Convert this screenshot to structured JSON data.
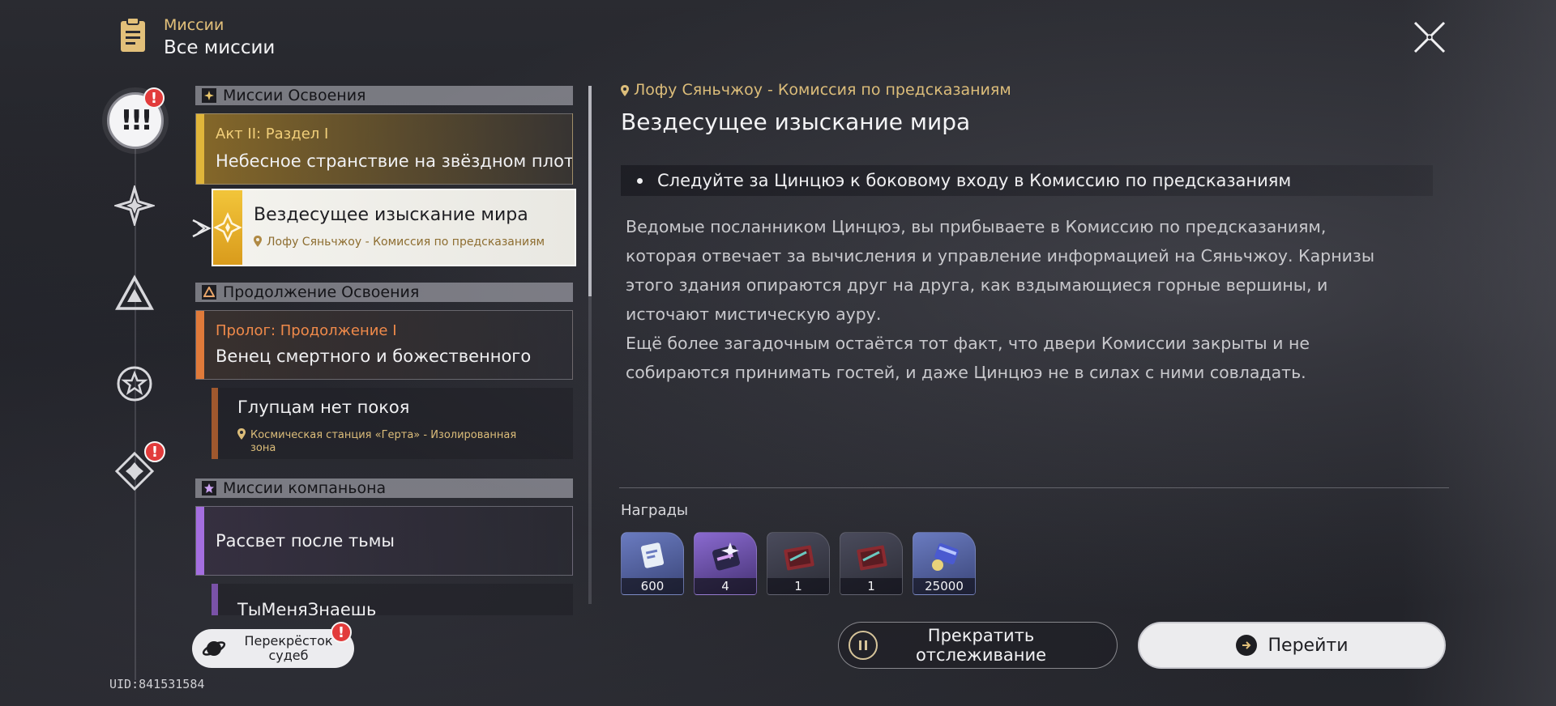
{
  "header": {
    "category": "Миссии",
    "title": "Все миссии"
  },
  "rail": {
    "active_label": "!!!",
    "badge": "!"
  },
  "uid": "UID:841531584",
  "list": {
    "categories": [
      {
        "label": "Миссии Освоения"
      },
      {
        "label": "Продолжение Освоения"
      },
      {
        "label": "Миссии компаньона"
      }
    ],
    "cards": [
      {
        "subtitle": "Акт II: Раздел I",
        "title": "Небесное странствие на звёздном плоту"
      },
      {
        "subtitle": "Пролог: Продолжение I",
        "title": "Венец смертного и божественного"
      },
      {
        "subtitle": "",
        "title": "Рассвет после тьмы"
      }
    ],
    "selected": {
      "title": "Вездесущее изыскание мира",
      "location": "Лофу Сяньчжоу - Комиссия по предсказаниям"
    },
    "sub_items": [
      {
        "title": "Глупцам нет покоя",
        "location_line1": "Космическая станция «Герта» - Изолированная",
        "location_line2": "зона"
      },
      {
        "title": "ТыМеняЗнаешь"
      }
    ]
  },
  "crossroads": {
    "line1": "Перекрёсток",
    "line2": "судеб",
    "badge": "!"
  },
  "detail": {
    "location": "Лофу Сяньчжоу - Комиссия по предсказаниям",
    "title": "Вездесущее изыскание мира",
    "objective": "Следуйте за Цинцюэ к боковому входу в Комиссию по предсказаниям",
    "description": [
      "Ведомые посланником Цинцюэ, вы прибываете в Комиссию по предсказаниям,",
      "которая отвечает за вычисления и управление информацией на Сяньчжоу. Карнизы",
      "этого здания опираются друг на друга, как вздымающиеся горные вершины, и",
      "источают мистическую ауру.",
      "Ещё более загадочным остаётся тот факт, что двери Комиссии закрыты и не",
      "собираются принимать гостей, и даже Цинцюэ не в силах с ними совладать."
    ],
    "rewards_label": "Награды",
    "rewards": [
      {
        "icon": "trailblaze-exp-icon",
        "qty": "600",
        "color": "#4e5f9c"
      },
      {
        "icon": "star-rail-pass-icon",
        "qty": "4",
        "color": "#5a4a92"
      },
      {
        "icon": "material-chest-icon",
        "qty": "1",
        "color": "#3c3d4a"
      },
      {
        "icon": "material-chest-icon",
        "qty": "1",
        "color": "#3c3d4a"
      },
      {
        "icon": "credit-icon",
        "qty": "25000",
        "color": "#4c5a94"
      }
    ]
  },
  "buttons": {
    "stop_line1": "Прекратить",
    "stop_line2": "отслеживание",
    "go": "Перейти"
  },
  "colors": {
    "accent_gold": "#e2c07a",
    "trailblaze_bar": "#e0b53a",
    "continuation_bar": "#e07a3a",
    "companion_bar": "#a46ee0",
    "badge_red": "#e23b3b"
  }
}
